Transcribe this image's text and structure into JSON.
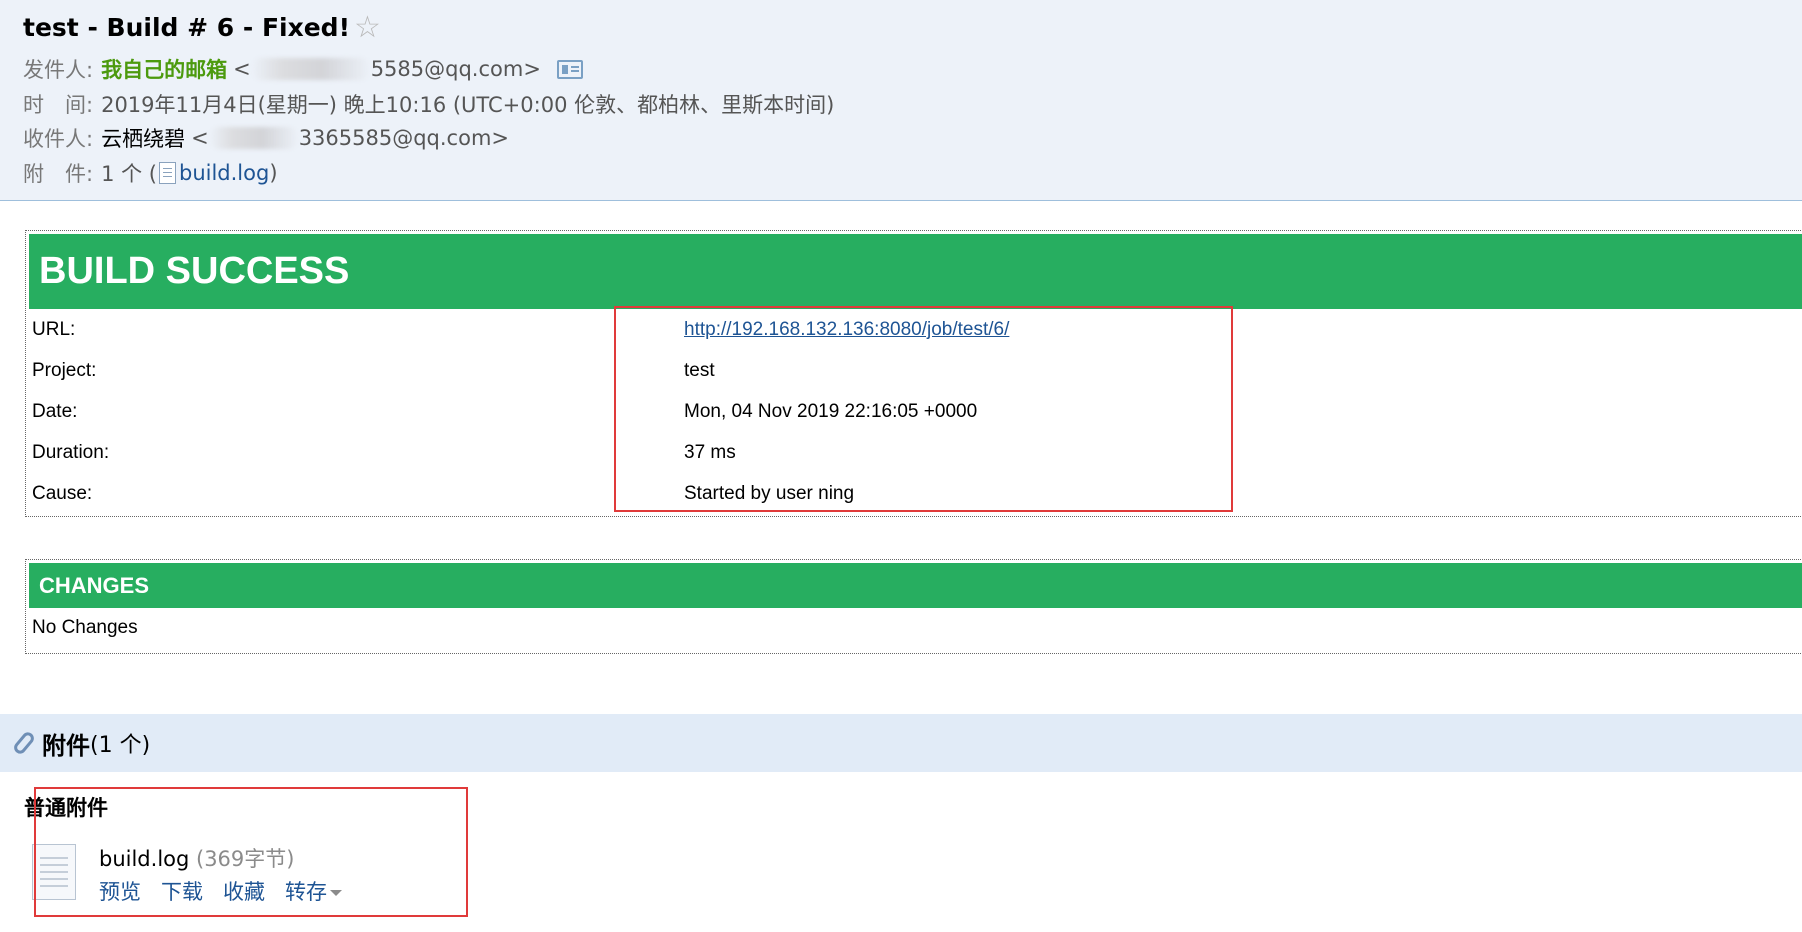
{
  "email": {
    "subject": "test - Build # 6 - Fixed!",
    "star_icon": "☆",
    "from_label": "发件人:",
    "from_name": "我自己的邮箱",
    "from_addr_prefix": "<",
    "from_addr_visible": "5585@qq.com>",
    "time_label": "时　间:",
    "time_value": "2019年11月4日(星期一) 晚上10:16 (UTC+0:00 伦敦、都柏林、里斯本时间)",
    "to_label": "收件人:",
    "to_name": "云栖绕碧",
    "to_addr_prefix": "<",
    "to_addr_visible": "3365585@qq.com>",
    "attach_label": "附　件:",
    "attach_count": "1 个 (",
    "attach_file": "build.log",
    "attach_close": ")"
  },
  "report": {
    "banner": "BUILD SUCCESS",
    "rows": [
      {
        "label": "URL:",
        "value": "http://192.168.132.136:8080/job/test/6/"
      },
      {
        "label": "Project:",
        "value": "test"
      },
      {
        "label": "Date:",
        "value": "Mon, 04 Nov 2019 22:16:05 +0000"
      },
      {
        "label": "Duration:",
        "value": "37 ms"
      },
      {
        "label": "Cause:",
        "value": "Started by user ning"
      }
    ],
    "changes_banner": "CHANGES",
    "no_changes": "No Changes"
  },
  "attachments": {
    "title": "附件",
    "count": "(1 个)",
    "section_label": "普通附件",
    "file_name": "build.log",
    "file_size": " (369字节)",
    "actions": {
      "preview": "预览",
      "download": "下载",
      "favorite": "收藏",
      "save_to": "转存"
    }
  },
  "colors": {
    "banner_green": "#27ae60",
    "annotation_red": "#e03a3a",
    "link_blue": "#1e5494"
  }
}
